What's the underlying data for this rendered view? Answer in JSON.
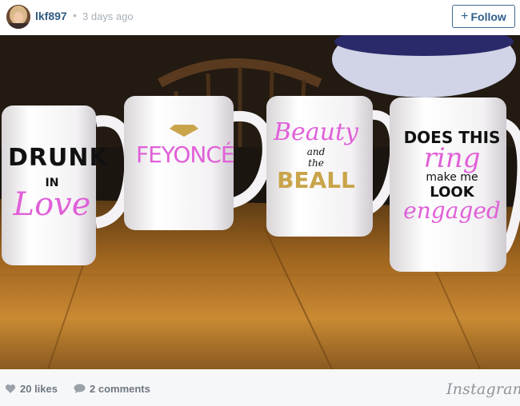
{
  "header": {
    "username": "lkf897",
    "separator": "•",
    "time_ago": "3 days ago",
    "follow_label": "Follow",
    "follow_icon": "+"
  },
  "photo": {
    "mug_texts": {
      "mug1": [
        "DRUNK",
        "IN",
        "Love"
      ],
      "mug2": [
        "FEYONCÉ"
      ],
      "mug3": [
        "Beauty",
        "and",
        "the",
        "BEALL"
      ],
      "mug4": [
        "DOES THIS",
        "ring",
        "make me",
        "LOOK",
        "engaged"
      ]
    }
  },
  "footer": {
    "likes_label": "20 likes",
    "comments_label": "2 comments",
    "brand": "Instagram",
    "like_icon": "heart-icon",
    "comment_icon": "speech-bubble-icon"
  },
  "colors": {
    "accent": "#2f5a80",
    "pink_text": "#e060d8",
    "gold_text": "#c9a44a"
  }
}
